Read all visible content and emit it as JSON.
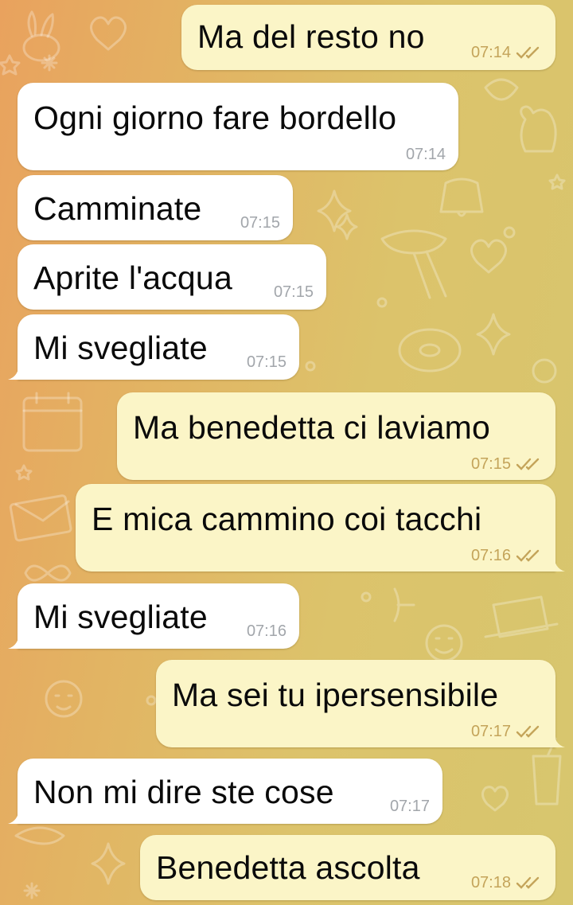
{
  "colors": {
    "incoming_bubble": "#ffffff",
    "outgoing_bubble": "#fbf5c7",
    "incoming_time": "#a2a6ab",
    "outgoing_time_and_ticks": "#c4a45a",
    "wallpaper_left": "#e9a25e",
    "wallpaper_right": "#d7c66e"
  },
  "wallpaper": {
    "style": "christmas-doodles",
    "icons": [
      "rabbit-icon",
      "heart-icon",
      "snowflake-icon",
      "star-icon",
      "calendar-icon",
      "bell-icon",
      "scarf-icon",
      "donut-icon",
      "envelope-icon",
      "bow-icon",
      "top-hat-icon",
      "smiley-icon",
      "cup-icon",
      "mitten-icon"
    ]
  },
  "messages": [
    {
      "direction": "out",
      "text": "Ma del resto no",
      "time": "07:14",
      "status": "read"
    },
    {
      "direction": "in",
      "text": "Ogni giorno fare bordello",
      "time": "07:14"
    },
    {
      "direction": "in",
      "text": "Camminate",
      "time": "07:15"
    },
    {
      "direction": "in",
      "text": "Aprite l'acqua",
      "time": "07:15"
    },
    {
      "direction": "in",
      "text": "Mi svegliate",
      "time": "07:15"
    },
    {
      "direction": "out",
      "text": "Ma benedetta ci laviamo",
      "time": "07:15",
      "status": "read"
    },
    {
      "direction": "out",
      "text": "E mica cammino coi tacchi",
      "time": "07:16",
      "status": "read"
    },
    {
      "direction": "in",
      "text": "Mi svegliate",
      "time": "07:16"
    },
    {
      "direction": "out",
      "text": "Ma sei tu ipersensibile",
      "time": "07:17",
      "status": "read"
    },
    {
      "direction": "in",
      "text": "Non mi dire ste cose",
      "time": "07:17"
    },
    {
      "direction": "out",
      "text": "Benedetta ascolta",
      "time": "07:18",
      "status": "read"
    }
  ]
}
